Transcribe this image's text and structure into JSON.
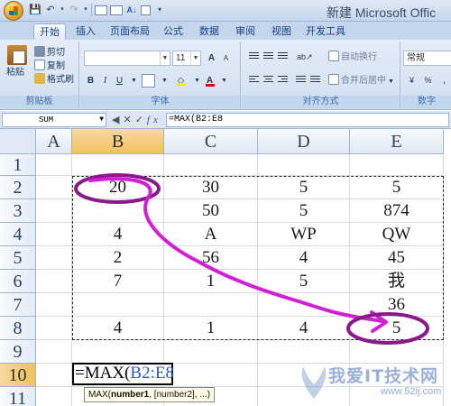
{
  "title": "新建 Microsoft Offic",
  "tabs": [
    "开始",
    "插入",
    "页面布局",
    "公式",
    "数据",
    "审阅",
    "视图",
    "开发工具"
  ],
  "ribbon": {
    "paste_label": "粘贴",
    "cut_label": "剪切",
    "copy_label": "复制",
    "format_painter_label": "格式刷",
    "clipboard_group": "剪贴板",
    "font_size": "11",
    "font_group": "字体",
    "wrap_text_label": "自动换行",
    "merge_center_label": "合并后居中",
    "alignment_group": "对齐方式",
    "number_format": "常规",
    "number_group": "数字"
  },
  "formula_bar": {
    "name_box": "SUM",
    "formula": "=MAX(B2:E8"
  },
  "columns": [
    "A",
    "B",
    "C",
    "D",
    "E"
  ],
  "rows": [
    "1",
    "2",
    "3",
    "4",
    "5",
    "6",
    "7",
    "8",
    "9",
    "10",
    "11"
  ],
  "cells": {
    "B2": "20",
    "C2": "30",
    "D2": "5",
    "E2": "5",
    "C3": "50",
    "D3": "5",
    "E3": "874",
    "B4": "4",
    "C4": "A",
    "D4": "WP",
    "E4": "QW",
    "B5": "2",
    "C5": "56",
    "D5": "4",
    "E5": "45",
    "B6": "7",
    "C6": "1",
    "D6": "5",
    "E6": "我",
    "E7": "36",
    "B8": "4",
    "C8": "1",
    "D8": "4",
    "E8": "5"
  },
  "edit_cell": {
    "prefix": "=MAX(",
    "range": "B2:E8"
  },
  "tooltip": {
    "func": "MAX(",
    "arg1": "number1",
    "rest": ", [number2], ...)"
  },
  "watermark": {
    "text": "我爱IT技术网",
    "url": "www.52ij.com"
  },
  "colors": {
    "annotation": "#d21ed6",
    "selected_header": "#f1c15f",
    "range_ref": "#2a58c7"
  }
}
